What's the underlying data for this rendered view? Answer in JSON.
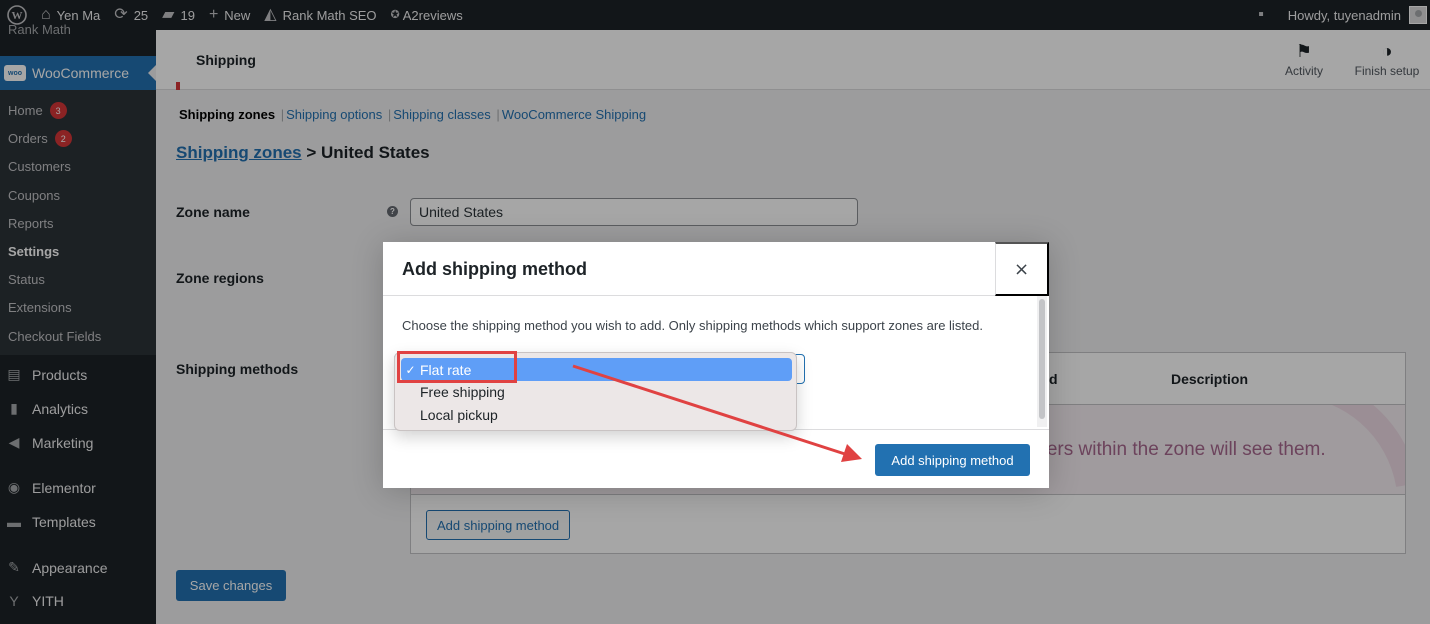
{
  "adminbar": {
    "site_name": "Yen Ma",
    "updates_count": "25",
    "comments_count": "19",
    "new_label": "New",
    "rank_math_label": "Rank Math SEO",
    "a2reviews_label": "A2reviews",
    "howdy_label": "Howdy, tuyenadmin"
  },
  "sidebar": {
    "cut_label": "Rank Math",
    "woocommerce_label": "WooCommerce",
    "sub_items": [
      {
        "label": "Home",
        "badge": "3"
      },
      {
        "label": "Orders",
        "badge": "2"
      },
      {
        "label": "Customers"
      },
      {
        "label": "Coupons"
      },
      {
        "label": "Reports"
      },
      {
        "label": "Settings"
      },
      {
        "label": "Status"
      },
      {
        "label": "Extensions"
      },
      {
        "label": "Checkout Fields"
      }
    ],
    "menu_items": [
      {
        "label": "Products",
        "icon": "archive-icon"
      },
      {
        "label": "Analytics",
        "icon": "bar-chart-icon"
      },
      {
        "label": "Marketing",
        "icon": "megaphone-icon"
      },
      {
        "label": "Elementor",
        "icon": "elementor-icon"
      },
      {
        "label": "Templates",
        "icon": "folder-icon"
      },
      {
        "label": "Appearance",
        "icon": "paintbrush-icon"
      },
      {
        "label": "YITH",
        "icon": "yith-icon"
      }
    ]
  },
  "header": {
    "title": "Shipping",
    "activity_label": "Activity",
    "finish_setup_label": "Finish setup"
  },
  "subnav": {
    "current": "Shipping zones",
    "links": [
      "Shipping options",
      "Shipping classes",
      "WooCommerce Shipping"
    ]
  },
  "zone": {
    "breadcrumb_link": "Shipping zones",
    "breadcrumb_rest": " > United States",
    "zone_name_label": "Zone name",
    "zone_name_value": "United States",
    "zone_regions_label": "Zone regions",
    "shipping_methods_label": "Shipping methods"
  },
  "methods_table": {
    "col_partial": "d",
    "col_description": "Description",
    "empty_text_partial": "mers within the zone will see them.",
    "add_button": "Add shipping method"
  },
  "save_button": "Save changes",
  "modal": {
    "title": "Add shipping method",
    "close": "×",
    "description": "Choose the shipping method you wish to add. Only shipping methods which support zones are listed.",
    "add_button": "Add shipping method"
  },
  "dropdown": {
    "selected": "Flat rate",
    "check": "✓",
    "options": [
      "Free shipping",
      "Local pickup"
    ]
  },
  "colors": {
    "accent": "#2271b1",
    "annotation_red": "#e04242"
  }
}
